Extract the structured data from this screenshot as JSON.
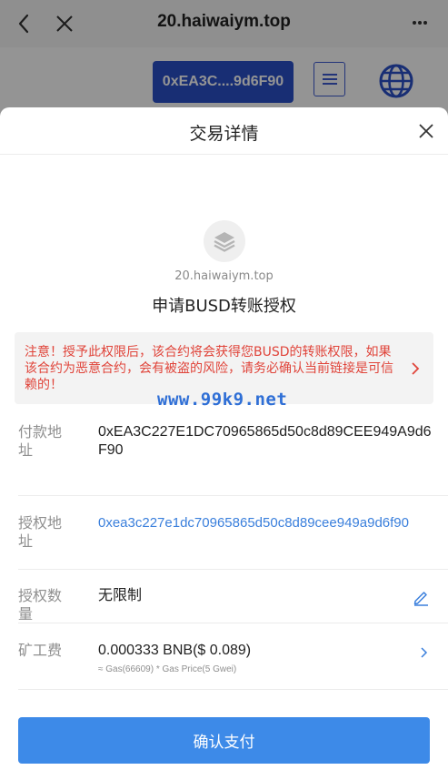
{
  "browser": {
    "title": "20.haiwaiym.top"
  },
  "page": {
    "wallet_address_short": "0xEA3C....9d6F90"
  },
  "sheet": {
    "title": "交易详情",
    "domain": "20.haiwaiym.top",
    "action": "申请BUSD转账授权",
    "warning": "注意！授予此权限后，该合约将会获得您BUSD的转账权限，如果该合约为恶意合约，会有被盗的风险，请务必确认当前链接是可信赖的！",
    "watermark": "www.99k9.net",
    "rows": {
      "payer": {
        "label": "付款地址",
        "value": "0xEA3C227E1DC70965865d50c8d89CEE949A9d6F90"
      },
      "spender": {
        "label": "授权地址",
        "value": "0xea3c227e1dc70965865d50c8d89cee949a9d6f90"
      },
      "amount": {
        "label": "授权数量",
        "value": "无限制"
      },
      "fee": {
        "label": "矿工费",
        "value": "0.000333 BNB($ 0.089)",
        "detail": "≈ Gas(66609) * Gas Price(5 Gwei)"
      }
    },
    "confirm_label": "确认支付"
  },
  "colors": {
    "primary": "#3d8ae8",
    "wallet_button": "#2a50c8",
    "warning_text": "#e0443a",
    "link": "#3a7fdc"
  }
}
